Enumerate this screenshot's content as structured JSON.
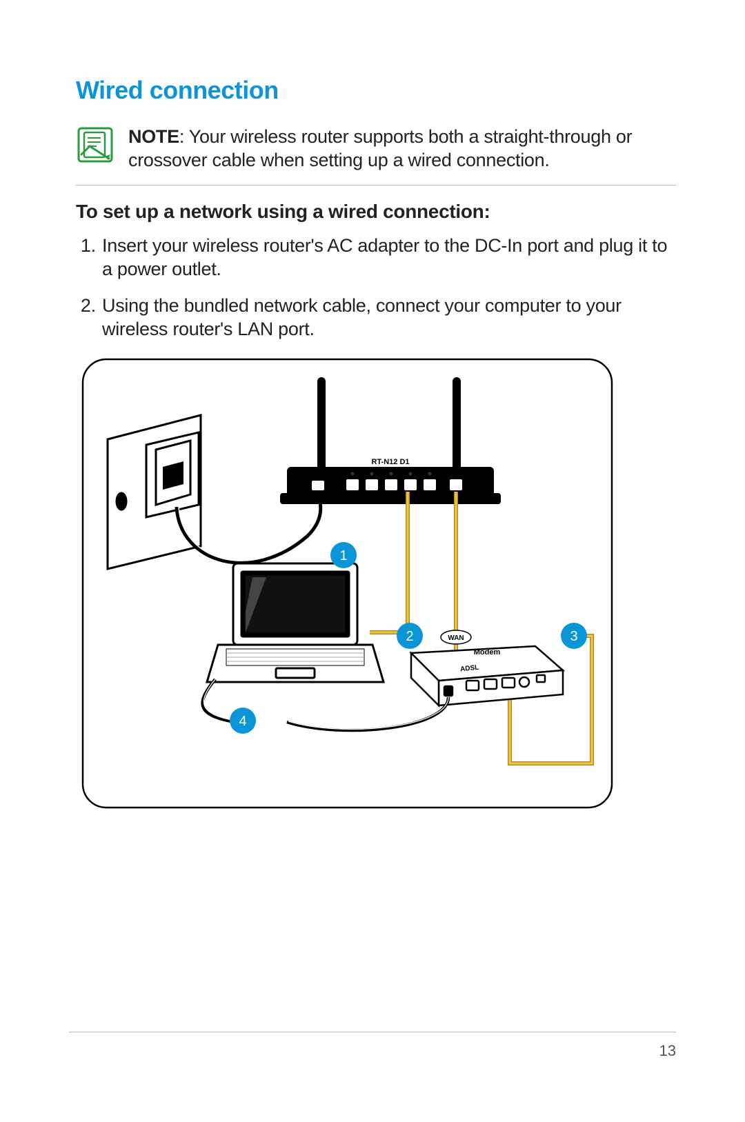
{
  "title": "Wired connection",
  "note": {
    "label": "NOTE",
    "text": ": Your wireless router supports both a straight-through or crossover cable when setting up a wired connection."
  },
  "subheading": "To set up a network using a wired connection:",
  "steps": [
    "Insert your wireless router's AC adapter to the DC-In port and plug it to a power outlet.",
    "Using the bundled network cable, connect your computer to your wireless router's LAN port."
  ],
  "diagram": {
    "router_model": "RT-N12 D1",
    "wan_label": "WAN",
    "modem_label": "Modem",
    "modem_type": "ADSL",
    "callouts": [
      "1",
      "2",
      "3",
      "4"
    ]
  },
  "page_number": "13"
}
